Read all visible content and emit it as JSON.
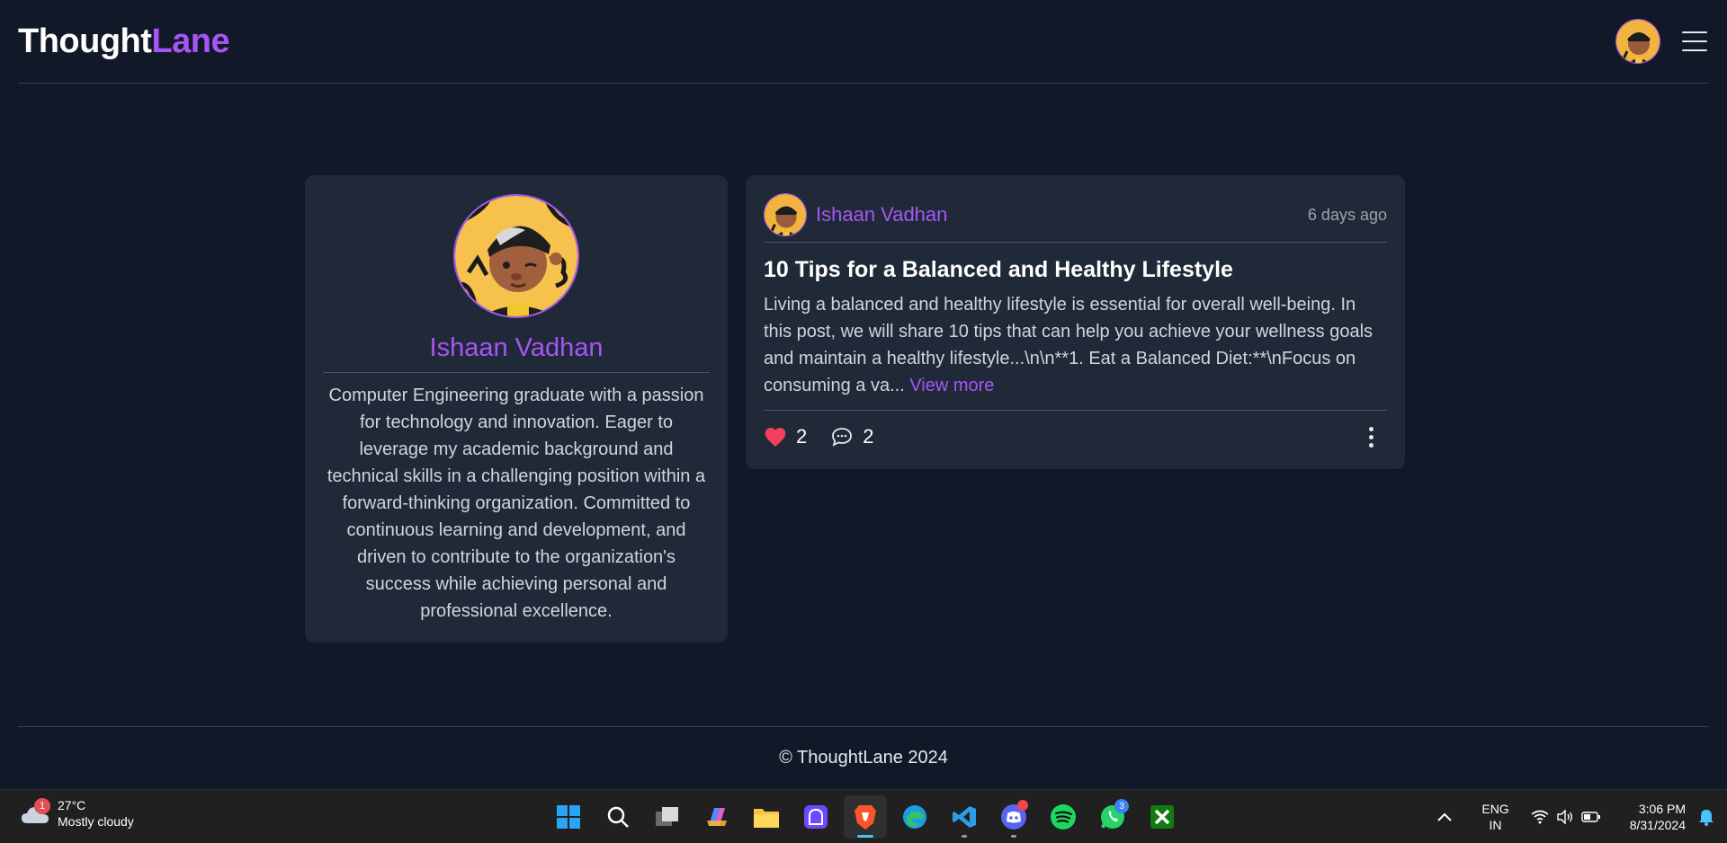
{
  "header": {
    "logo_part1": "Thought",
    "logo_part2": "Lane"
  },
  "profile": {
    "name": "Ishaan Vadhan",
    "bio": "Computer Engineering graduate with a passion for technology and innovation. Eager to leverage my academic background and technical skills in a challenging position within a forward-thinking organization. Committed to continuous learning and development, and driven to contribute to the organization's success while achieving personal and professional excellence."
  },
  "post": {
    "author": "Ishaan Vadhan",
    "time": "6 days ago",
    "title": "10 Tips for a Balanced and Healthy Lifestyle",
    "excerpt": "Living a balanced and healthy lifestyle is essential for overall well-being. In this post, we will share 10 tips that can help you achieve your wellness goals and maintain a healthy lifestyle...\\n\\n**1. Eat a Balanced Diet:**\\nFocus on consuming a va...",
    "view_more": "View more",
    "likes": "2",
    "comments": "2"
  },
  "footer": {
    "copyright": "© ThoughtLane 2024"
  },
  "taskbar": {
    "weather_badge": "1",
    "temperature": "27°C",
    "condition": "Mostly cloudy",
    "whatsapp_badge": "3",
    "lang_line1": "ENG",
    "lang_line2": "IN",
    "time": "3:06 PM",
    "date": "8/31/2024",
    "apps": [
      "start",
      "search",
      "task-view",
      "copilot",
      "file-explorer",
      "proton-vpn",
      "brave",
      "edge",
      "vscode",
      "discord",
      "spotify",
      "whatsapp",
      "xbox"
    ]
  },
  "colors": {
    "background": "#111827",
    "card": "#1f2937",
    "accent": "#a855f7",
    "heart": "#f43f5e"
  }
}
